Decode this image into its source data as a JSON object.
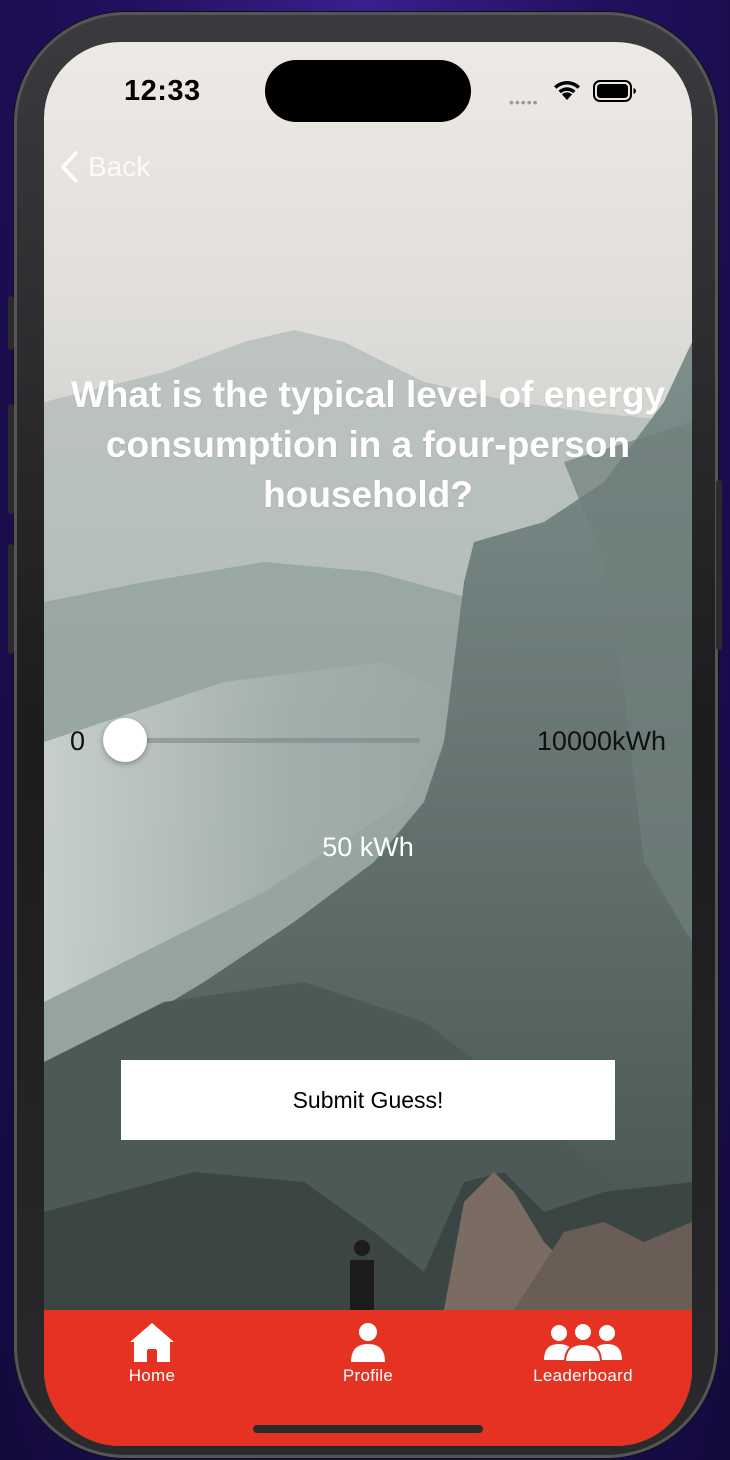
{
  "status_bar": {
    "time": "12:33"
  },
  "nav": {
    "back_label": "Back"
  },
  "question": {
    "text": "What is the typical level of energy consumption in a four-person household?"
  },
  "slider": {
    "min_label": "0",
    "max_label": "10000kWh",
    "min_value": 0,
    "max_value": 10000,
    "current_value": 50
  },
  "value_display": {
    "text": "50 kWh"
  },
  "submit": {
    "label": "Submit Guess!"
  },
  "tab_bar": {
    "accent_color": "#e63222",
    "items": [
      {
        "label": "Home",
        "icon": "home-icon"
      },
      {
        "label": "Profile",
        "icon": "user-icon"
      },
      {
        "label": "Leaderboard",
        "icon": "users-group-icon"
      }
    ]
  }
}
